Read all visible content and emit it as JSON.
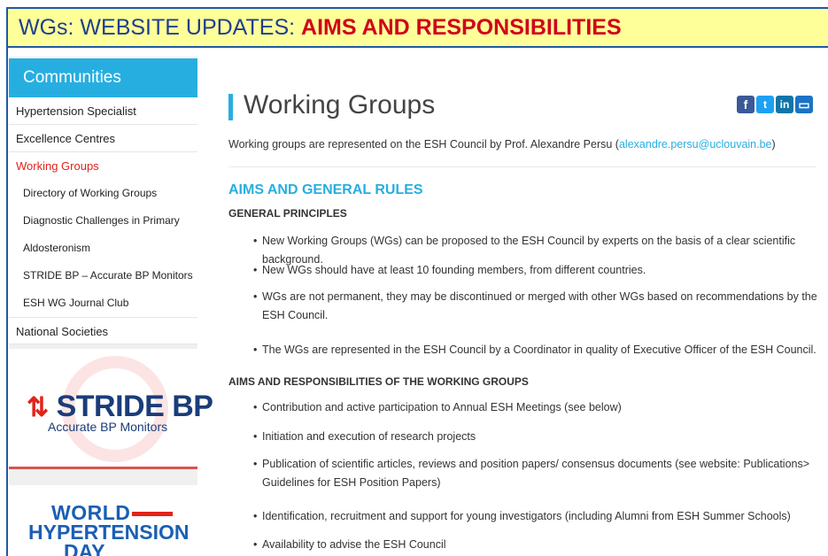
{
  "banner": {
    "prefix": "WGs: WEBSITE UPDATES: ",
    "highlight": "AIMS AND RESPONSIBILITIES"
  },
  "sidebar": {
    "header": "Communities",
    "items": [
      {
        "label": "Hypertension Specialist"
      },
      {
        "label": "Excellence Centres"
      },
      {
        "label": "Working Groups"
      },
      {
        "label": "Directory of Working Groups"
      },
      {
        "label": "Diagnostic Challenges in Primary"
      },
      {
        "label": "Aldosteronism"
      },
      {
        "label": "STRIDE BP – Accurate BP Monitors"
      },
      {
        "label": "ESH WG Journal Club"
      },
      {
        "label": "National Societies"
      }
    ],
    "ad_stride": {
      "title": "STRIDE BP",
      "subtitle": "Accurate BP Monitors"
    },
    "ad_world": {
      "line1": "WORLD",
      "line2": "HYPERTENSION",
      "line3": "DAY"
    }
  },
  "main": {
    "title": "Working Groups",
    "intro_text": "Working groups are represented on the ESH Council by Prof. Alexandre Persu (",
    "intro_email": "alexandre.persu@uclouvain.be",
    "intro_close": ")",
    "section_heading": "AIMS AND GENERAL RULES",
    "principles_heading": "GENERAL PRINCIPLES",
    "principles": [
      "New Working Groups (WGs) can be proposed to the ESH Council by experts on the basis of a clear scientific background.",
      "New WGs should have at least 10 founding members, from different countries.",
      "WGs are not permanent, they may be discontinued or merged with other WGs based on recommendations by the ESH Council.",
      "The WGs are represented in the ESH Council by a Coordinator in quality of Executive Officer of the ESH Council."
    ],
    "aims_heading": "AIMS AND RESPONSIBILITIES OF THE WORKING GROUPS",
    "aims": [
      "Contribution and active participation to Annual ESH Meetings (see below)",
      "Initiation and execution of research projects",
      "Publication of scientific articles, reviews and position papers/ consensus documents (see website: Publications> Guidelines for ESH Position Papers)",
      "Identification, recruitment and support for young investigators (including Alumni from ESH Summer Schools)",
      "Availability to advise the ESH Council"
    ]
  },
  "share": {
    "icons": [
      "facebook-icon",
      "twitter-icon",
      "linkedin-icon",
      "print-icon"
    ],
    "glyphs": [
      "f",
      "t",
      "in",
      "▭"
    ]
  },
  "colors": {
    "accent": "#27aee0",
    "active_nav": "#e2231a",
    "banner_bg": "#ffff99",
    "banner_highlight": "#d0021b"
  }
}
